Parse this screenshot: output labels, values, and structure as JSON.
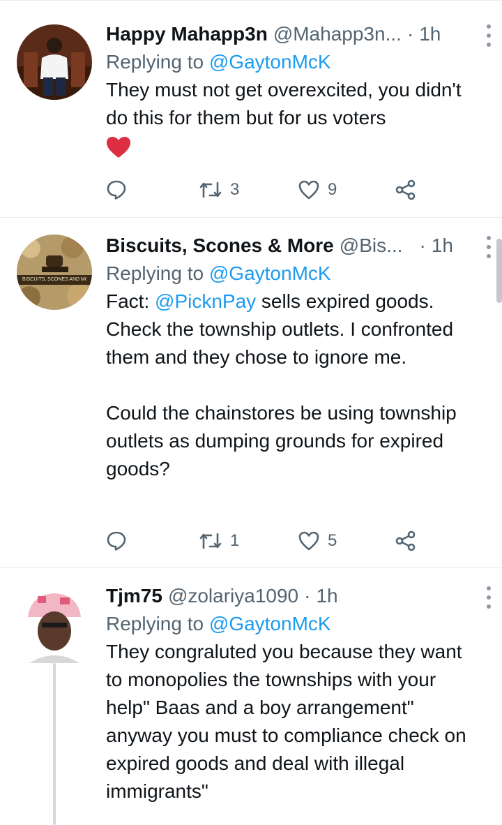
{
  "tweets": [
    {
      "name": "Happy Mahapp3n",
      "handle": "@Mahapp3n...",
      "dot": "·",
      "time": "1h",
      "replying_prefix": "Replying to ",
      "replying_to": "@GaytonMcK",
      "text": "They must not get overexcited, you didn't do this for them but for us voters",
      "emoji": "heart",
      "replies": "",
      "retweets": "3",
      "likes": "9",
      "avatar_icon": "profile-photo"
    },
    {
      "name": "Biscuits, Scones & More",
      "handle": "@Bis...",
      "dot": "·",
      "time": "1h",
      "replying_prefix": "Replying to ",
      "replying_to": "@GaytonMcK",
      "text_prefix": "Fact: ",
      "text_mention": "@PicknPay",
      "text_rest": " sells expired goods. Check the township outlets. I confronted them and they chose to ignore me.\n\nCould the chainstores be using township outlets as dumping grounds for expired goods?",
      "replies": "",
      "retweets": "1",
      "likes": "5",
      "avatar_label": "BISCUITS, SCONES AND MORE",
      "avatar_icon": "bakery-logo"
    },
    {
      "name": "Tjm75",
      "handle": "@zolariya1090",
      "dot": "·",
      "time": "1h",
      "replying_prefix": "Replying to ",
      "replying_to": "@GaytonMcK",
      "text": "They congraluted you because they want to monopolies the townships with your help\" Baas and a boy arrangement\" anyway you must to compliance check on expired goods and deal with illegal immigrants\"",
      "avatar_icon": "profile-photo"
    }
  ],
  "colors": {
    "link": "#1d9bf0",
    "secondary_text": "#536471",
    "divider": "#e6ecf0",
    "heart": "#e0245e"
  }
}
